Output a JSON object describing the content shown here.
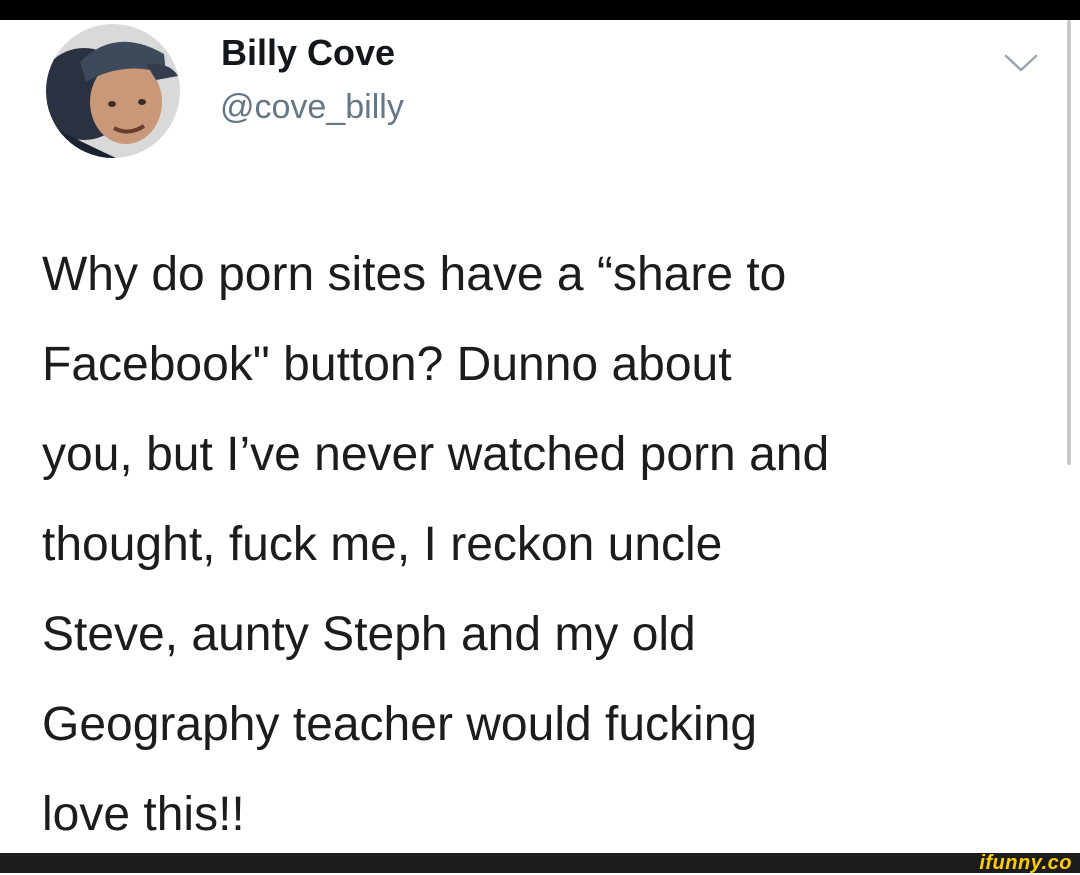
{
  "tweet": {
    "author": {
      "display_name": "Billy Cove",
      "handle": "@cove_billy",
      "avatar_icon": "profile-photo"
    },
    "menu_icon": "chevron-down-icon",
    "lines": [
      "Why do porn sites have a “share to",
      "Facebook\" button? Dunno about",
      "you, but I’ve never watched porn and",
      "thought, fuck me, I reckon uncle",
      "Steve, aunty Steph and my old",
      "Geography teacher would fucking",
      "love this!!"
    ]
  },
  "watermark": {
    "text": "ifunny.co",
    "color": "#ffcc00"
  },
  "colors": {
    "name": "#14171a",
    "handle": "#657786",
    "text": "#1c1c1c",
    "background": "#ffffff"
  }
}
